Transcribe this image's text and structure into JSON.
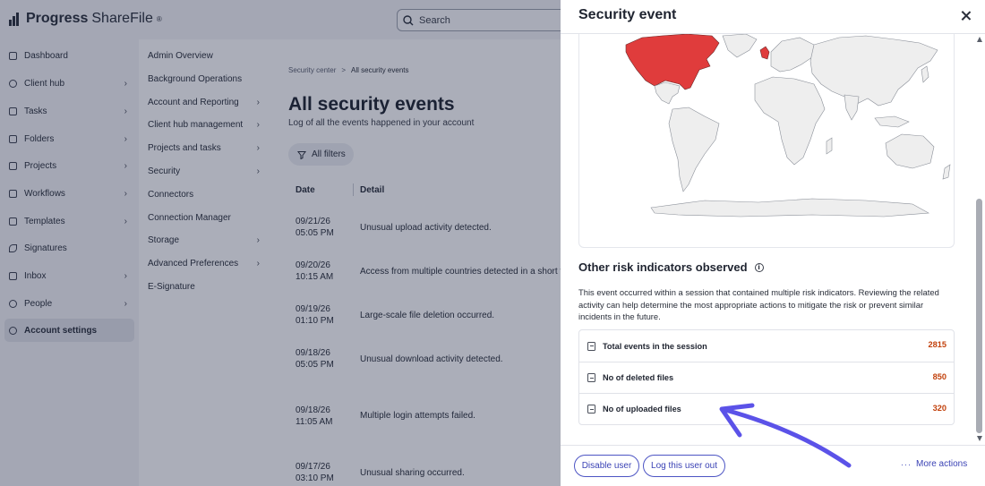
{
  "app": {
    "brand": "Progress",
    "brand_product": "ShareFile",
    "brand_reg": "®"
  },
  "search": {
    "label": "Search"
  },
  "sidebar": {
    "items": [
      {
        "label": "Dashboard",
        "chevron": false
      },
      {
        "label": "Client hub",
        "chevron": true
      },
      {
        "label": "Tasks",
        "chevron": true
      },
      {
        "label": "Folders",
        "chevron": true
      },
      {
        "label": "Projects",
        "chevron": true
      },
      {
        "label": "Workflows",
        "chevron": true
      },
      {
        "label": "Templates",
        "chevron": true
      },
      {
        "label": "Signatures",
        "chevron": false
      },
      {
        "label": "Inbox",
        "chevron": true
      },
      {
        "label": "People",
        "chevron": true
      },
      {
        "label": "Account settings",
        "chevron": false,
        "active": true
      }
    ]
  },
  "submenu": {
    "items": [
      {
        "label": "Admin Overview",
        "chevron": false
      },
      {
        "label": "Background Operations",
        "chevron": false
      },
      {
        "label": "Account and Reporting",
        "chevron": true
      },
      {
        "label": "Client hub management",
        "chevron": true
      },
      {
        "label": "Projects and tasks",
        "chevron": true
      },
      {
        "label": "Security",
        "chevron": true
      },
      {
        "label": "Connectors",
        "chevron": false
      },
      {
        "label": "Connection Manager",
        "chevron": false
      },
      {
        "label": "Storage",
        "chevron": true
      },
      {
        "label": "Advanced Preferences",
        "chevron": true
      },
      {
        "label": "E-Signature",
        "chevron": false
      }
    ]
  },
  "main": {
    "breadcrumb": {
      "root": "Security center",
      "separator": ">",
      "current": "All security events"
    },
    "title": "All security events",
    "subtitle": "Log of all the events happened in your account",
    "filters_label": "All filters",
    "columns": {
      "date": "Date",
      "detail": "Detail"
    },
    "rows": [
      {
        "date": "09/21/26",
        "time": "05:05 PM",
        "detail": "Unusual upload activity detected."
      },
      {
        "date": "09/20/26",
        "time": "10:15 AM",
        "detail": "Access from multiple countries detected in a short time"
      },
      {
        "date": "09/19/26",
        "time": "01:10 PM",
        "detail": "Large-scale file deletion occurred."
      },
      {
        "date": "09/18/26",
        "time": "05:05 PM",
        "detail": "Unusual download activity detected."
      },
      {
        "date": "09/18/26",
        "time": "11:05 AM",
        "detail": "Multiple login attempts failed."
      },
      {
        "date": "09/17/26",
        "time": "03:10 PM",
        "detail": "Unusual sharing occurred."
      }
    ]
  },
  "drawer": {
    "title": "Security event",
    "risk": {
      "title": "Other risk indicators observed",
      "description": "This event occurred within a session that contained multiple risk indicators. Reviewing the related activity can help determine the most appropriate actions to mitigate the risk or prevent similar incidents in the future.",
      "stats": [
        {
          "label": "Total events in the session",
          "value": "2815"
        },
        {
          "label": "No of deleted files",
          "value": "850"
        },
        {
          "label": "No of uploaded files",
          "value": "320"
        }
      ]
    },
    "footer": {
      "disable_user": "Disable user",
      "log_out": "Log this user out",
      "more_actions": "More actions",
      "more_dots": "···"
    }
  },
  "colors": {
    "accent": "#3b43b5",
    "stat_value": "#c2410c",
    "map_highlight": "#e03c3c",
    "map_land": "#eeeeee",
    "annotation_arrow": "#5b52e8"
  }
}
